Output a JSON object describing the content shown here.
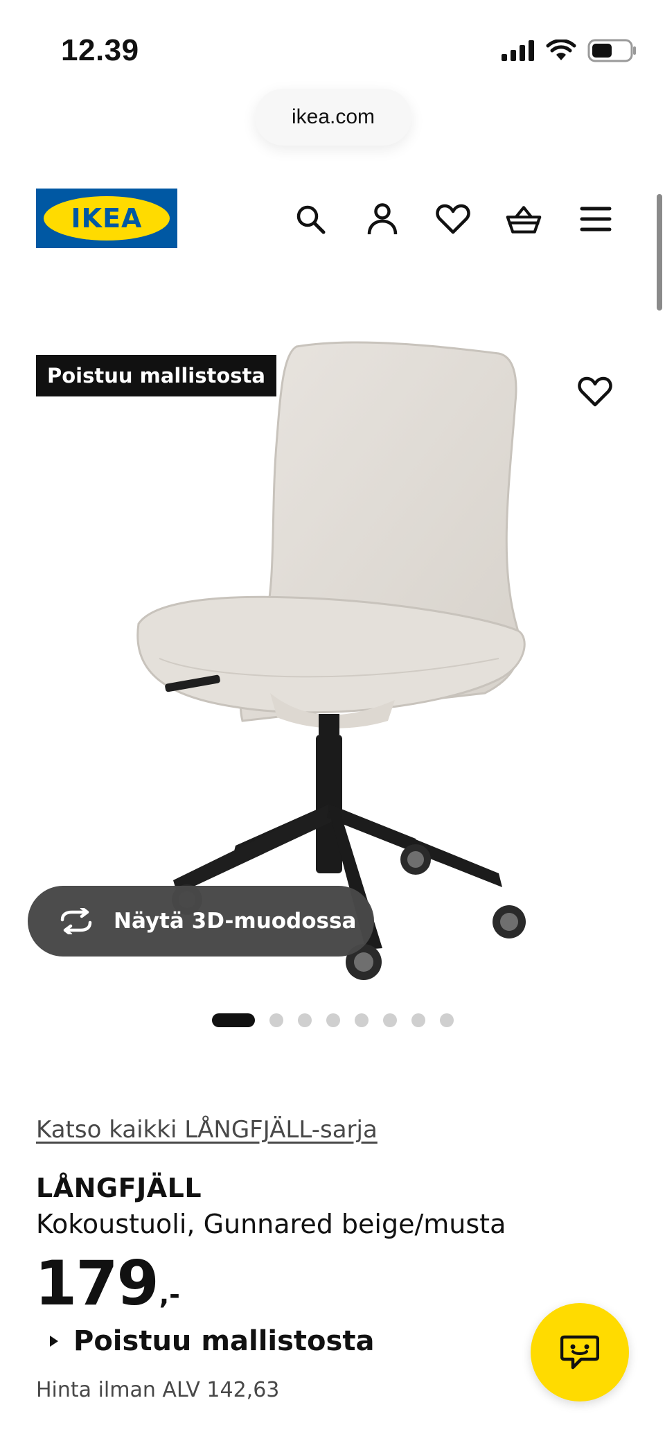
{
  "status_bar": {
    "time": "12.39"
  },
  "browser": {
    "url": "ikea.com"
  },
  "header": {
    "logo_text": "IKEA",
    "icons": [
      "search-icon",
      "account-icon",
      "favourites-icon",
      "cart-icon",
      "menu-icon"
    ]
  },
  "product": {
    "badge": "Poistuu mallistosta",
    "view_3d_label": "Näytä 3D-muodossa",
    "carousel": {
      "total": 8,
      "active": 1
    },
    "series_link": "Katso kaikki LÅNGFJÄLL-sarja",
    "name": "LÅNGFJÄLL",
    "description": "Kokoustuoli, Gunnared beige/musta",
    "price": "179",
    "price_suffix": ",-",
    "discontinued_label": "Poistuu mallistosta",
    "vat_price": "Hinta ilman ALV 142,63"
  },
  "colors": {
    "ikea_blue": "#0058a3",
    "ikea_yellow": "#ffdb00",
    "badge_black": "#111111",
    "pill_gray": "#484848"
  }
}
